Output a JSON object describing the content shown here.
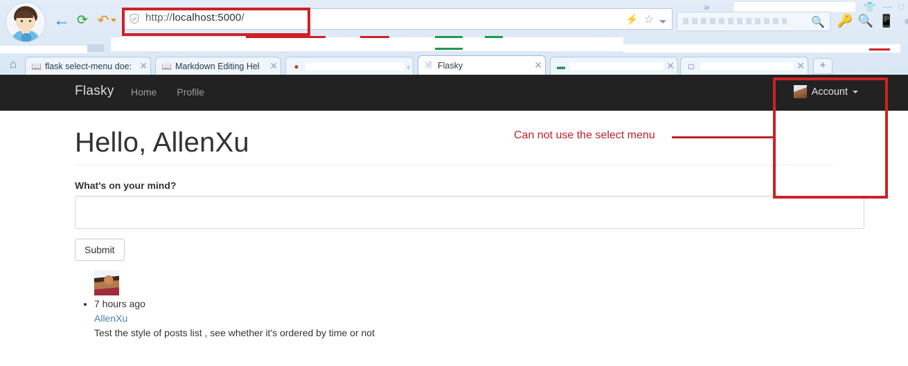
{
  "browser": {
    "address": {
      "url_prefix": "http://",
      "url_host": "localhost:5000",
      "url_suffix": "/",
      "full_url": "http://localhost:5000/",
      "shield_icon": "shield-check-icon",
      "bolt_icon": "lightning-icon",
      "star_icon": "star-icon",
      "caret_icon": "chevron-down-icon"
    },
    "nav": {
      "back_icon": "back-arrow-icon",
      "reload_icon": "reload-icon",
      "undo_icon": "undo-arrow-icon",
      "home_icon": "home-icon"
    },
    "search": {
      "placeholder": "",
      "value": "",
      "search_icon": "search-icon"
    },
    "toolbar_icons": [
      {
        "name": "key-icon",
        "glyph": "⚷"
      },
      {
        "name": "magnifier-page-icon",
        "glyph": "⚲"
      },
      {
        "name": "send-to-device-icon",
        "glyph": "❐"
      },
      {
        "name": "more-icon",
        "glyph": "●"
      }
    ],
    "window_controls": {
      "skin_icon": "\u0001",
      "minimize": "—",
      "maximize": "□",
      "close": "✕"
    },
    "overflow_chevron": "»",
    "tabs": [
      {
        "title": "flask select-menu doe:",
        "favicon": "book-icon",
        "active": false,
        "redacted": false,
        "close_label": "✕"
      },
      {
        "title": "Markdown Editing Hel",
        "favicon": "book-icon",
        "active": false,
        "redacted": false,
        "close_label": "✕"
      },
      {
        "title": "",
        "favicon": "",
        "active": false,
        "redacted": true,
        "close_label": "‹"
      },
      {
        "title": "Flasky",
        "favicon": "page-icon",
        "active": true,
        "redacted": false,
        "close_label": "✕"
      },
      {
        "title": "",
        "favicon": "",
        "active": false,
        "redacted": true,
        "close_label": "✕"
      },
      {
        "title": "",
        "favicon": "",
        "active": false,
        "redacted": true,
        "close_label": "✕"
      }
    ],
    "new_tab_label": "+"
  },
  "site": {
    "navbar": {
      "brand": "Flasky",
      "links": [
        {
          "label": "Home"
        },
        {
          "label": "Profile"
        }
      ],
      "account": {
        "label": "Account",
        "avatar_icon": "account-avatar",
        "caret_icon": "caret-down-icon"
      }
    },
    "header": {
      "greeting": "Hello, AllenXu"
    },
    "compose": {
      "label": "What's on your mind?",
      "textarea_value": "",
      "textarea_placeholder": "",
      "submit_label": "Submit"
    },
    "posts": [
      {
        "avatar_icon": "post-avatar",
        "timestamp": "7 hours ago",
        "author": "AllenXu",
        "body": "Test the style of posts list , see whether it's ordered by time or not"
      }
    ]
  },
  "annotations": {
    "note_text": "Can not use the select menu",
    "color": "#c0202a",
    "box_color": "#cf2027"
  }
}
